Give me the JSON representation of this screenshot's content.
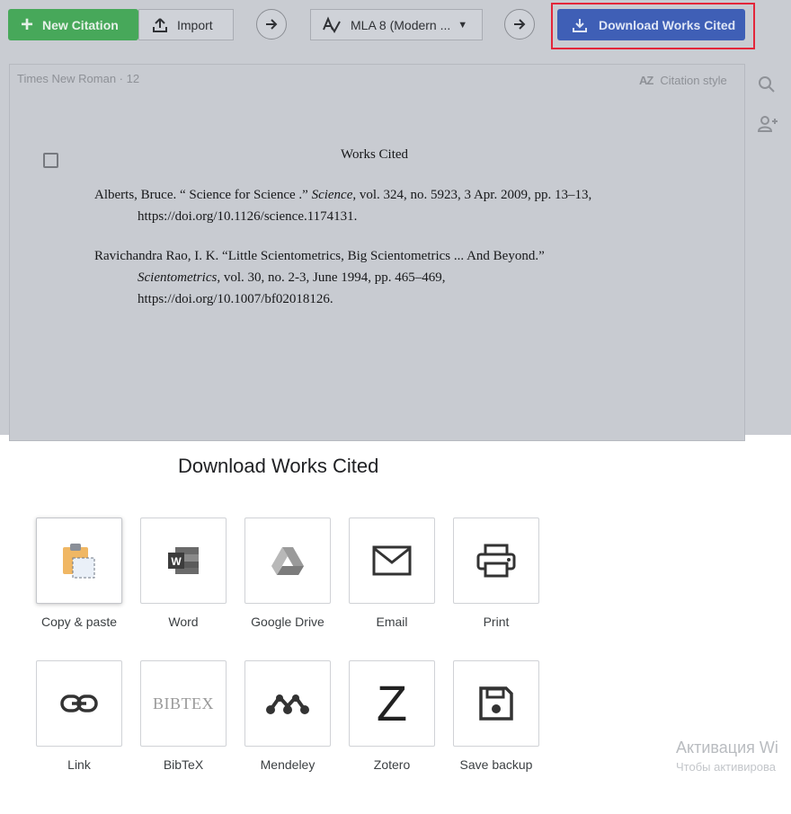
{
  "toolbar": {
    "new_citation": "New Citation",
    "import": "Import",
    "style_select": "MLA 8 (Modern ...",
    "download": "Download Works Cited"
  },
  "document": {
    "font_info": "Times New Roman · 12",
    "citation_style": "Citation style",
    "az_icon_text": "AZ",
    "title": "Works Cited",
    "entries": [
      {
        "first_pre": "Alberts, Bruce. “ Science for Science .” ",
        "first_italic": "Science",
        "first_post": ", vol. 324, no. 5923, 3 Apr. 2009, pp. 13–13,",
        "second": "https://doi.org/10.1126/science.1174131."
      },
      {
        "first": "Ravichandra Rao, I. K. “Little Scientometrics, Big Scientometrics ... And Beyond.”",
        "second_italic": "Scientometrics",
        "second_post": ", vol. 30, no. 2-3, June 1994, pp. 465–469,",
        "third": "https://doi.org/10.1007/bf02018126."
      }
    ]
  },
  "download_panel": {
    "title": "Download Works Cited",
    "options": [
      {
        "label": "Copy & paste",
        "icon": "clipboard-icon"
      },
      {
        "label": "Word",
        "icon": "word-icon"
      },
      {
        "label": "Google Drive",
        "icon": "google-drive-icon"
      },
      {
        "label": "Email",
        "icon": "envelope-icon"
      },
      {
        "label": "Print",
        "icon": "printer-icon"
      },
      {
        "label": "Link",
        "icon": "link-icon"
      },
      {
        "label": "BibTeX",
        "icon": "bibtex-logo"
      },
      {
        "label": "Mendeley",
        "icon": "mendeley-icon"
      },
      {
        "label": "Zotero",
        "icon": "zotero-icon"
      },
      {
        "label": "Save backup",
        "icon": "floppy-disk-icon"
      }
    ],
    "bibtex_logo_text": "BIBTEX",
    "zotero_logo_text": "Z",
    "word_logo_text": "W"
  },
  "watermark": {
    "line1": "Активация Wi",
    "line2": "Чтобы активирова"
  },
  "colors": {
    "new_citation_green": "#47a85a",
    "download_blue": "#3f5fb6",
    "highlight_red": "#e3263a",
    "overlay_gray": "#c9ccd2"
  }
}
